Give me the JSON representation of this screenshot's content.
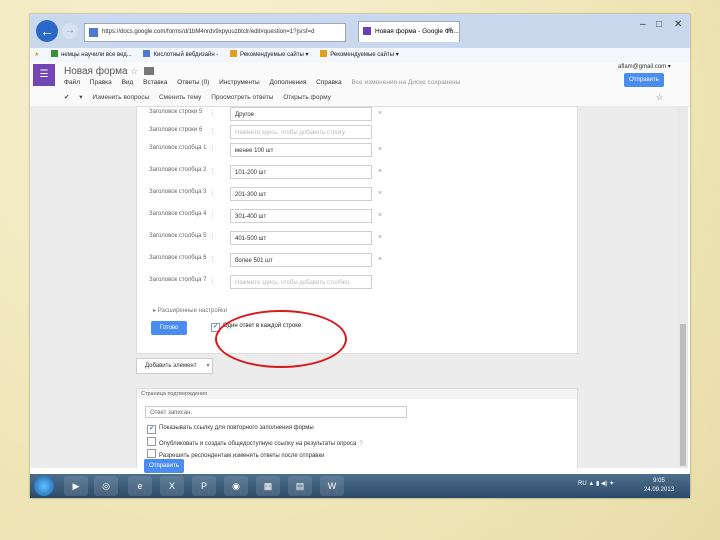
{
  "browser": {
    "url": "https://docs.google.com/forms/d/1bM4nrdv9xpyuuzbtclr/edit#question=1?jsrsf=d",
    "tab_title": "Новая форма - Google Фо...",
    "tab_close": "×",
    "back_icon": "back-arrow-icon",
    "forward_icon": "forward-arrow-icon",
    "address_icons": "⌕ ▾ ⟳ ✕",
    "window_controls": {
      "minimize": "–",
      "maximize": "□",
      "close": "✕"
    }
  },
  "favorites": {
    "items": [
      {
        "label": "немцы научили все вед...",
        "color": "#3a8f3a"
      },
      {
        "label": "Кислотный вебдизайн -",
        "color": "#4a7bd0"
      },
      {
        "label": "Рекомендуемые сайты ▾",
        "color": "#e0a020"
      },
      {
        "label": "Рекомендуемые сайты ▾",
        "color": "#e0a020"
      }
    ]
  },
  "app": {
    "logo_glyph": "☰",
    "title": "Новая форма",
    "star": "☆",
    "menu": [
      "Файл",
      "Правка",
      "Вид",
      "Вставка",
      "Ответы (0)",
      "Инструменты",
      "Дополнения",
      "Справка"
    ],
    "autosave": "Все изменения на Диске сохранены",
    "email": "aflam@gmail.com ▾",
    "send_label": "Отправить",
    "toolbar": [
      "✔",
      "▾",
      "Изменить вопросы",
      "Сменить тему",
      "Просмотреть ответы",
      "Открыть форму"
    ],
    "toolbar_star": "☆"
  },
  "form": {
    "rows": [
      {
        "label": "Заголовок строки 5",
        "value": "Другое",
        "placeholder": false
      },
      {
        "label": "Заголовок строки 6",
        "value": "Нажмите здесь, чтобы добавить строку",
        "placeholder": true
      },
      {
        "label": "Заголовок столбца 1",
        "value": "менее 100 шт",
        "placeholder": false
      },
      {
        "label": "Заголовок столбца 2",
        "value": "101-200 шт",
        "placeholder": false
      },
      {
        "label": "Заголовок столбца 3",
        "value": "201-300 шт",
        "placeholder": false
      },
      {
        "label": "Заголовок столбца 4",
        "value": "301-400 шт",
        "placeholder": false
      },
      {
        "label": "Заголовок столбца 5",
        "value": "401-500 шт",
        "placeholder": false
      },
      {
        "label": "Заголовок столбца 6",
        "value": "более 501 шт",
        "placeholder": false
      },
      {
        "label": "Заголовок столбца 7",
        "value": "Нажмите здесь, чтобы добавить столбец",
        "placeholder": true
      }
    ],
    "remove_glyph": "×",
    "advanced": "▸ Расширенные настройки",
    "ready_label": "Готово",
    "single_answer": "Один ответ в каждой строке",
    "single_answer_checked": true,
    "add_item": "Добавить элемент",
    "add_item_dd": "▾"
  },
  "confirmation": {
    "header": "Страница подтверждения",
    "input_value": "Ответ записан.",
    "options": [
      {
        "label": "Показывать ссылку для повторного заполнения формы",
        "checked": true,
        "help": ""
      },
      {
        "label": "Опубликовать и создать общедоступную ссылку на результаты опроса",
        "checked": false,
        "help": "?"
      },
      {
        "label": "Разрешить респондентам изменять ответы после отправки",
        "checked": false,
        "help": ""
      }
    ],
    "submit_label": "Отправить"
  },
  "taskbar": {
    "apps": [
      "▶",
      "◎",
      "e",
      "X",
      "P",
      "◉",
      "▦",
      "▤",
      "W"
    ],
    "tray": "RU  ▲  ▮  ◀)  ✦",
    "time": "9:05",
    "date": "24.09.2013"
  },
  "colors": {
    "accent": "#4a8cf0",
    "annotation": "#d8191c",
    "forms_purple": "#7247b3"
  }
}
